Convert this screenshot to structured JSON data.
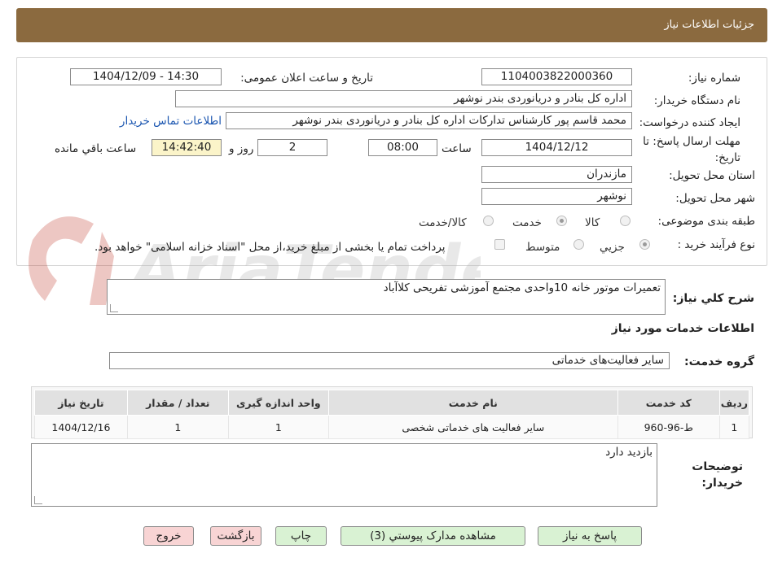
{
  "header": {
    "title": "جزئیات اطلاعات نیاز"
  },
  "form": {
    "need_number_label": "شماره نیاز:",
    "need_number": "1104003822000360",
    "announce_label": "تاریخ و ساعت اعلان عمومی:",
    "announce_value": "1404/12/09 - 14:30",
    "buyer_org_label": "نام دستگاه خریدار:",
    "buyer_org": "اداره کل بنادر و دریانوردی بندر نوشهر",
    "requester_label": "ایجاد کننده درخواست:",
    "requester": "محمد قاسم پور کارشناس تدارکات اداره کل بنادر و دریانوردی بندر نوشهر",
    "contact_link": "اطلاعات تماس خریدار",
    "deadline_label_1": "مهلت ارسال پاسخ: تا",
    "deadline_label_2": "تاریخ:",
    "deadline_date": "1404/12/12",
    "time_label": "ساعت",
    "deadline_time": "08:00",
    "days_value": "2",
    "days_label": "روز و",
    "remaining_time": "14:42:40",
    "remaining_label": "ساعت باقي مانده",
    "province_label": "استان محل تحویل:",
    "province": "مازندران",
    "city_label": "شهر محل تحویل:",
    "city": "نوشهر",
    "category_label": "طبقه بندی موضوعی:",
    "category_options": [
      "کالا",
      "خدمت",
      "کالا/خدمت"
    ],
    "category_selected": "خدمت",
    "process_label": "نوع فرآیند خرید :",
    "process_options": [
      "جزيي",
      "متوسط"
    ],
    "process_note": "پرداخت تمام یا بخشی از مبلغ خرید،از محل \"اسناد خزانه اسلامی\" خواهد بود."
  },
  "description": {
    "label": "شرح کلي نياز:",
    "value": "تعمیرات موتور خانه 10واحدی مجتمع آموزشی تفریحی کلاآباد"
  },
  "services": {
    "section_title": "اطلاعات خدمات مورد نياز",
    "group_label": "گروه خدمت:",
    "group_value": "سایر فعالیت‌های خدماتی",
    "table": {
      "headers": [
        "ردیف",
        "کد خدمت",
        "نام خدمت",
        "واحد اندازه گیری",
        "تعداد / مقدار",
        "تاریخ نیاز"
      ],
      "rows": [
        [
          "1",
          "ط-96-960",
          "سایر فعالیت های خدماتی شخصی",
          "1",
          "1",
          "1404/12/16"
        ]
      ]
    }
  },
  "buyer_notes": {
    "label_1": "توضیحات",
    "label_2": "خریدار:",
    "value": "بازدید دارد"
  },
  "buttons": {
    "reply": "پاسخ به نیاز",
    "attachments": "مشاهده مدارک پیوستي (3)",
    "print": "چاپ",
    "back": "بازگشت",
    "exit": "خروج"
  },
  "watermark": {
    "text": "AriaTender.neT"
  },
  "colors": {
    "header_bg": "#8b6a3f",
    "green_button": "#d9f2d3",
    "pink_button": "#f8d4d4",
    "remaining_bg": "#fbf4c9",
    "link": "#1a55b0",
    "watermark": "#c0392b"
  }
}
